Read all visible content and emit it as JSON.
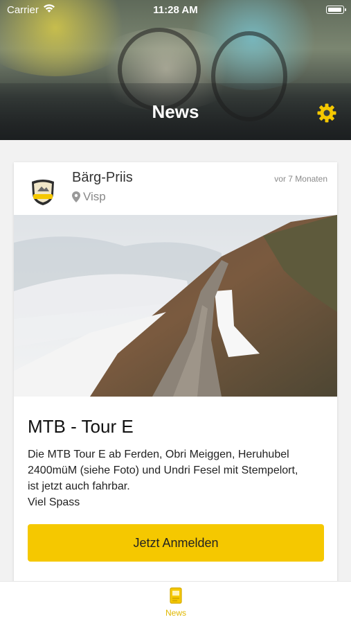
{
  "status_bar": {
    "carrier": "Carrier",
    "time": "11:28 AM"
  },
  "header": {
    "title": "News"
  },
  "post": {
    "author": "Bärg-Priis",
    "location": "Visp",
    "time_ago": "vor 7 Monaten",
    "title": "MTB - Tour E",
    "body_lines": [
      "Die MTB Tour E ab Ferden, Obri Meiggen, Heruhubel",
      "2400müM (siehe Foto) und Undri Fesel mit Stempelort,",
      "ist jetzt auch fahrbar.",
      "Viel Spass"
    ],
    "button_label": "Jetzt Anmelden"
  },
  "tab_bar": {
    "items": [
      {
        "label": "News",
        "icon": "news-icon",
        "active": true
      }
    ]
  },
  "colors": {
    "accent": "#F5C800",
    "tab_active": "#E0B800"
  }
}
